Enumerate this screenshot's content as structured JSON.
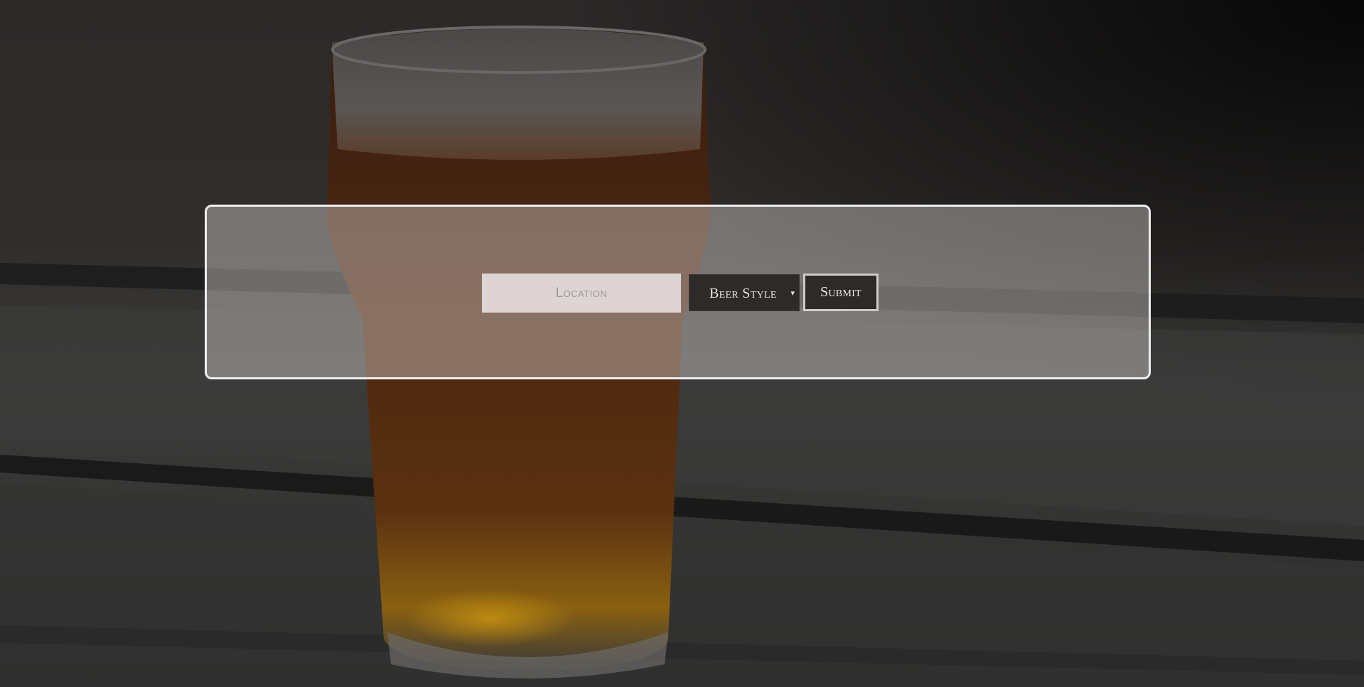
{
  "search": {
    "location_placeholder": "Location",
    "location_value": "",
    "beer_style_selected": "Beer Style",
    "submit_label": "Submit"
  },
  "colors": {
    "panel_border": "#eeeeee",
    "button_background": "#2e2a29",
    "input_background": "#ece4e6"
  },
  "icons": {
    "select_caret": "▾"
  }
}
